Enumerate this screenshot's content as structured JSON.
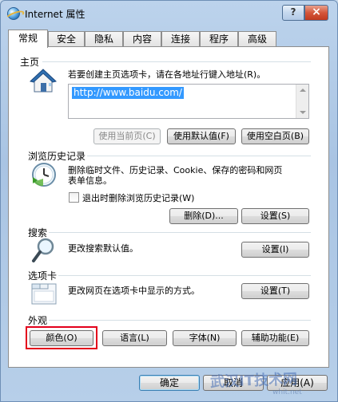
{
  "window": {
    "title": "Internet 属性",
    "help_label": "?",
    "close_label": "×"
  },
  "tabs": [
    {
      "label": "常规",
      "active": true
    },
    {
      "label": "安全"
    },
    {
      "label": "隐私"
    },
    {
      "label": "内容"
    },
    {
      "label": "连接"
    },
    {
      "label": "程序"
    },
    {
      "label": "高级"
    }
  ],
  "home": {
    "title": "主页",
    "desc": "若要创建主页选项卡，请在各地址行键入地址(R)。",
    "url": "http://www.baidu.com/",
    "use_current": "使用当前页(C)",
    "use_default": "使用默认值(F)",
    "use_blank": "使用空白页(B)"
  },
  "history": {
    "title": "浏览历史记录",
    "desc_line1": "删除临时文件、历史记录、Cookie、保存的密码和网页",
    "desc_line2": "表单信息。",
    "checkbox_label": "退出时删除浏览历史记录(W)",
    "delete_button": "删除(D)...",
    "settings_button": "设置(S)"
  },
  "search": {
    "title": "搜索",
    "desc": "更改搜索默认值。",
    "settings_button": "设置(I)"
  },
  "tabs_section": {
    "title": "选项卡",
    "desc": "更改网页在选项卡中显示的方式。",
    "settings_button": "设置(T)"
  },
  "appearance": {
    "title": "外观",
    "colors_button": "颜色(O)",
    "languages_button": "语言(L)",
    "fonts_button": "字体(N)",
    "accessibility_button": "辅助功能(E)"
  },
  "footer": {
    "ok": "确定",
    "cancel": "取消",
    "apply": "应用(A)"
  },
  "watermark": {
    "text": "武汉IT技术网",
    "url": "whit.net"
  }
}
